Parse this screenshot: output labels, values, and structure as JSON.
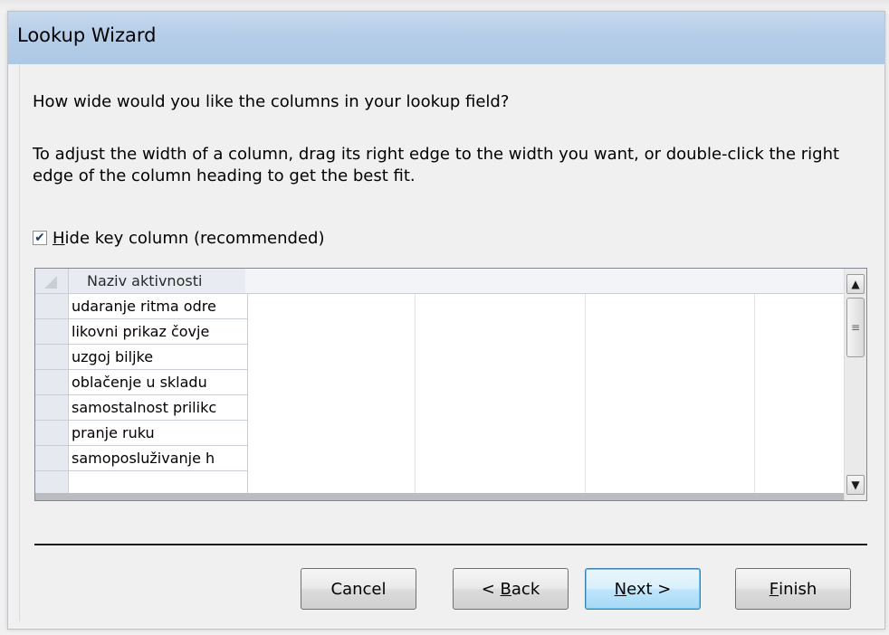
{
  "window": {
    "title": "Lookup Wizard"
  },
  "prompt": {
    "question": "How wide would you like the columns in your lookup field?",
    "instructions": "To adjust the width of a column, drag its right edge to the width you want, or double-click the right edge of the column heading to get the best fit."
  },
  "hide_key_column": {
    "checked": true,
    "label_first_letter": "H",
    "label_rest": "ide key column (recommended)"
  },
  "grid": {
    "column_header": "Naziv aktivnosti",
    "rows": [
      "udaranje ritma odre",
      "likovni  prikaz čovje",
      "uzgoj biljke",
      "oblačenje u skladu ",
      "samostalnost prilikc",
      "pranje ruku",
      "samoposluživanje h"
    ]
  },
  "buttons": {
    "cancel": "Cancel",
    "back_prefix": "< ",
    "back_mnemonic": "B",
    "back_rest": "ack",
    "next_mnemonic": "N",
    "next_rest": "ext >",
    "finish_mnemonic": "F",
    "finish_rest": "inish"
  },
  "icons": {
    "checkbox": "checkmark-icon",
    "scroll_up": "arrow-up-icon",
    "scroll_down": "arrow-down-icon",
    "scroll_thumb": "grip-icon"
  },
  "colors": {
    "titlebar": "#b5cde8",
    "default_button_border": "#3c7fb1"
  }
}
